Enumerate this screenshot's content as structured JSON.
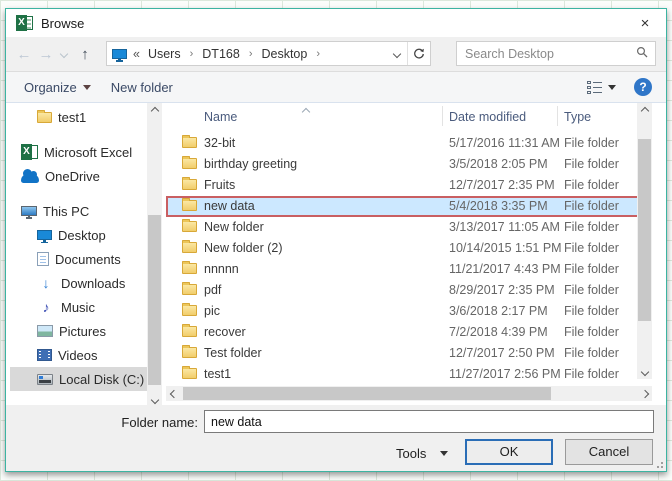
{
  "window": {
    "title": "Browse",
    "close_glyph": "×"
  },
  "nav": {
    "breadcrumb": {
      "prefix": "«",
      "segments": [
        {
          "label": "Users",
          "sep": "›"
        },
        {
          "label": "DT168",
          "sep": "›"
        },
        {
          "label": "Desktop",
          "sep": "›"
        }
      ]
    },
    "search": {
      "placeholder": "Search Desktop"
    }
  },
  "toolbar": {
    "organize_label": "Organize",
    "new_folder_label": "New folder"
  },
  "sidebar": {
    "items": [
      {
        "label": "test1",
        "icon": "folder",
        "indent": true,
        "gap": true
      },
      {
        "label": "Microsoft Excel",
        "icon": "excel"
      },
      {
        "label": "OneDrive",
        "icon": "cloud",
        "gap": true
      },
      {
        "label": "This PC",
        "icon": "pc"
      },
      {
        "label": "Desktop",
        "icon": "desktop",
        "indent": true
      },
      {
        "label": "Documents",
        "icon": "doc",
        "indent": true
      },
      {
        "label": "Downloads",
        "icon": "download",
        "indent": true
      },
      {
        "label": "Music",
        "icon": "music",
        "indent": true
      },
      {
        "label": "Pictures",
        "icon": "pic",
        "indent": true
      },
      {
        "label": "Videos",
        "icon": "video",
        "indent": true
      },
      {
        "label": "Local Disk (C:)",
        "icon": "disk",
        "indent": true,
        "selected": true
      }
    ]
  },
  "filelist": {
    "columns": {
      "name": "Name",
      "date": "Date modified",
      "type": "Type"
    },
    "rows": [
      {
        "name": "32-bit",
        "date": "5/17/2016 11:31 AM",
        "type": "File folder"
      },
      {
        "name": "birthday greeting",
        "date": "3/5/2018 2:05 PM",
        "type": "File folder"
      },
      {
        "name": "Fruits",
        "date": "12/7/2017 2:35 PM",
        "type": "File folder"
      },
      {
        "name": "new data",
        "date": "5/4/2018 3:35 PM",
        "type": "File folder",
        "selected": true
      },
      {
        "name": "New folder",
        "date": "3/13/2017 11:05 AM",
        "type": "File folder"
      },
      {
        "name": "New folder (2)",
        "date": "10/14/2015 1:51 PM",
        "type": "File folder"
      },
      {
        "name": "nnnnn",
        "date": "11/21/2017 4:43 PM",
        "type": "File folder"
      },
      {
        "name": "pdf",
        "date": "8/29/2017 2:35 PM",
        "type": "File folder"
      },
      {
        "name": "pic",
        "date": "3/6/2018 2:17 PM",
        "type": "File folder"
      },
      {
        "name": "recover",
        "date": "7/2/2018 4:39 PM",
        "type": "File folder"
      },
      {
        "name": "Test folder",
        "date": "12/7/2017 2:50 PM",
        "type": "File folder"
      },
      {
        "name": "test1",
        "date": "11/27/2017 2:56 PM",
        "type": "File folder"
      }
    ]
  },
  "footer": {
    "folder_name_label": "Folder name:",
    "folder_name_value": "new data",
    "tools_label": "Tools",
    "ok_label": "OK",
    "cancel_label": "Cancel"
  },
  "colors": {
    "dialog_border": "#3cb4a2",
    "selection_fill": "#cce8ff",
    "annotation_border": "#c95f62",
    "excel_green": "#1e7145",
    "help_blue": "#2f76c8",
    "ok_border_blue": "#2a6db6",
    "sidebar_selected": "#d9d9d9"
  }
}
